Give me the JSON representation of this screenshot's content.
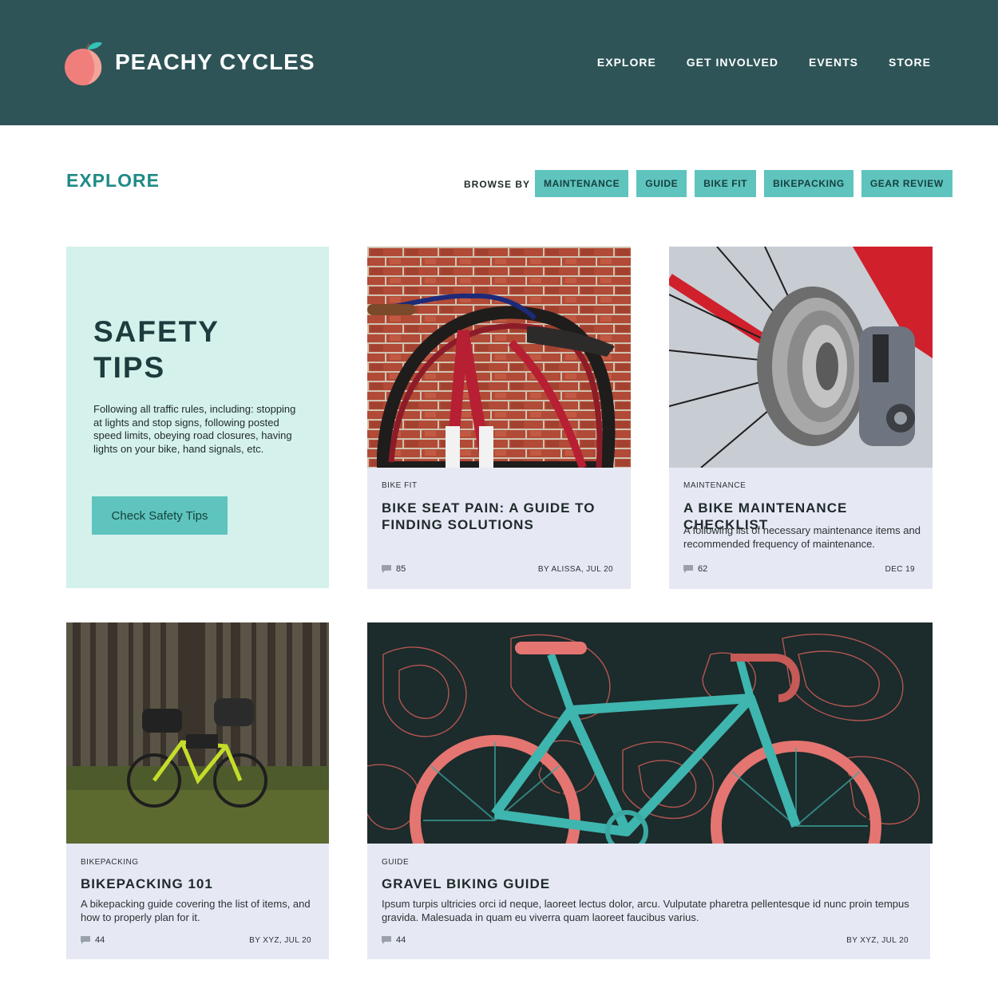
{
  "header": {
    "brand": "PEACHY CYCLES",
    "nav": [
      "EXPLORE",
      "GET INVOLVED",
      "EVENTS",
      "STORE"
    ]
  },
  "explore": {
    "title": "EXPLORE",
    "browse_label": "BROWSE BY",
    "filters": [
      "MAINTENANCE",
      "GUIDE",
      "BIKE FIT",
      "BIKEPACKING",
      "GEAR REVIEW"
    ]
  },
  "safety": {
    "title_line1": "SAFETY",
    "title_line2": "TIPS",
    "body": "Following all traffic rules, including: stopping at lights and stop signs, following posted speed limits, obeying road closures, having lights on your bike, hand signals, etc.",
    "button": "Check Safety Tips"
  },
  "articles": [
    {
      "category": "BIKE FIT",
      "title": "BIKE SEAT PAIN: A GUIDE TO FINDING SOLUTIONS",
      "description": "",
      "comments": "85",
      "meta": "BY ALISSA, JUL 20"
    },
    {
      "category": "MAINTENANCE",
      "title": "A BIKE MAINTENANCE CHECKLIST",
      "description": "A following list of necessary maintenance items and recommended frequency of maintenance.",
      "comments": "62",
      "meta": "DEC 19"
    },
    {
      "category": "BIKEPACKING",
      "title": "BIKEPACKING 101",
      "description": "A bikepacking guide covering the list of items, and how to properly plan for it.",
      "comments": "44",
      "meta": "BY XYZ, JUL 20"
    },
    {
      "category": "GUIDE",
      "title": "GRAVEL BIKING GUIDE",
      "description": "Ipsum turpis ultricies orci id neque, laoreet lectus dolor, arcu. Vulputate pharetra pellentesque id nunc proin tempus gravida. Malesuada in quam eu viverra quam laoreet faucibus varius.",
      "comments": "44",
      "meta": "BY XYZ, JUL 20"
    }
  ],
  "colors": {
    "header_bg": "#2e5457",
    "accent": "#5ec4bd",
    "explore_title": "#1e8a86",
    "safety_bg": "#d5f1ec",
    "card_bg": "#e6e9f4",
    "peach": "#f07f7c"
  },
  "icons": {
    "logo": "peach-icon",
    "comments": "comment-bubble-icon"
  }
}
